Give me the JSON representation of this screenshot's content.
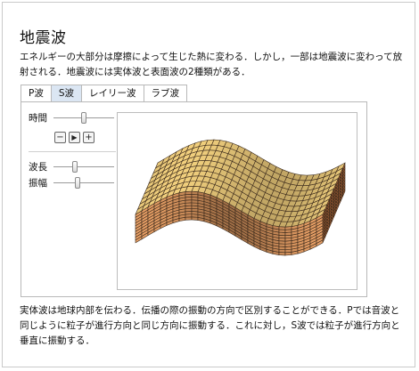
{
  "header": {
    "title": "地震波"
  },
  "intro": {
    "text": "エネルギーの大部分は摩擦によって生じた熱に変わる．しかし，一部は地震波に変わって放射される．地震波には実体波と表面波の2種類がある．"
  },
  "tabs": [
    {
      "label": "P波",
      "active": false
    },
    {
      "label": "S波",
      "active": true
    },
    {
      "label": "レイリー波",
      "active": false
    },
    {
      "label": "ラブ波",
      "active": false
    }
  ],
  "controls": {
    "time": {
      "label": "時間",
      "level": 0.5
    },
    "step_buttons": {
      "minus": "−",
      "play": "▶",
      "plus": "+"
    },
    "wavelength": {
      "label": "波長",
      "level": 0.35
    },
    "amplitude": {
      "label": "振幅",
      "level": 0.4
    }
  },
  "colors": {
    "block_face": "#e8a066",
    "block_top": "#f2d07e",
    "grid_line": "#3b2a1c",
    "tab_active": "#dbe6f3"
  },
  "outro": {
    "text": "実体波は地球内部を伝わる．伝播の際の振動の方向で区別することができる．Pでは音波と同じように粒子が進行方向と同じ方向に振動する．これに対し，S波では粒子が進行方向と垂直に振動する．"
  }
}
